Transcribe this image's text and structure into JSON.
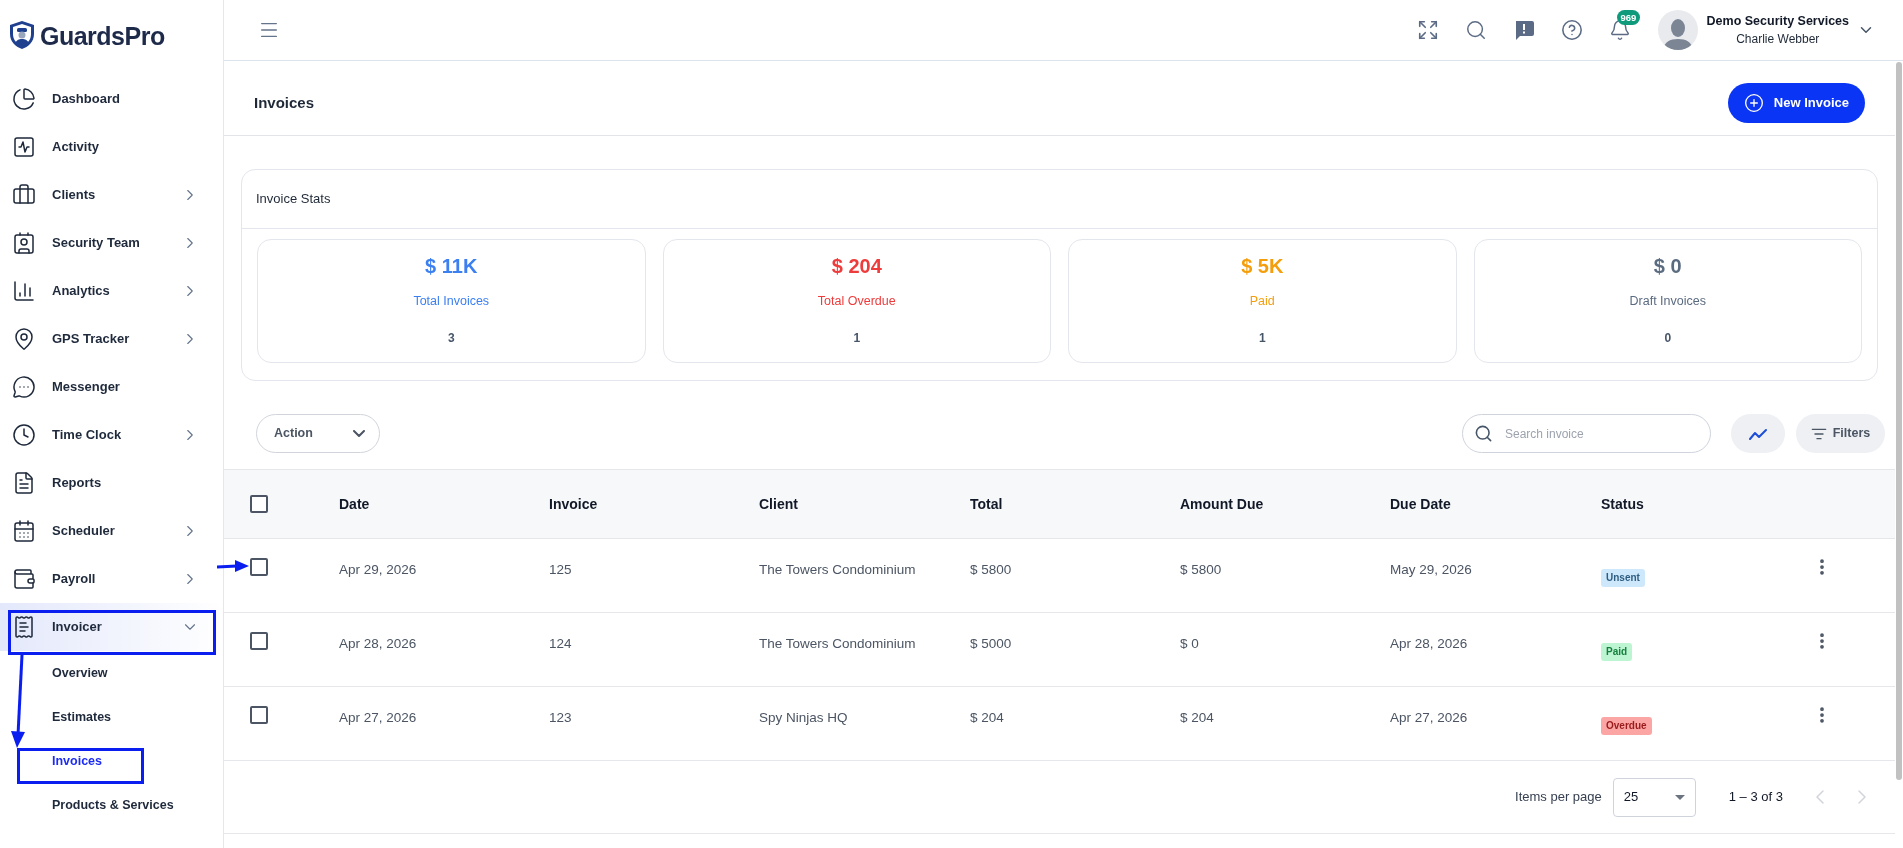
{
  "brand": "GuardsPro",
  "sidebar": {
    "items": [
      {
        "label": "Dashboard",
        "kind": "link",
        "selected": false
      },
      {
        "label": "Activity",
        "kind": "link",
        "selected": false
      },
      {
        "label": "Clients",
        "kind": "group",
        "expanded": false,
        "selected": false
      },
      {
        "label": "Security Team",
        "kind": "group",
        "expanded": false,
        "selected": false
      },
      {
        "label": "Analytics",
        "kind": "group",
        "expanded": false,
        "selected": false
      },
      {
        "label": "GPS Tracker",
        "kind": "group",
        "expanded": false,
        "selected": false
      },
      {
        "label": "Messenger",
        "kind": "link",
        "selected": false
      },
      {
        "label": "Time Clock",
        "kind": "group",
        "expanded": false,
        "selected": false
      },
      {
        "label": "Reports",
        "kind": "link",
        "selected": false
      },
      {
        "label": "Scheduler",
        "kind": "group",
        "expanded": false,
        "selected": false
      },
      {
        "label": "Payroll",
        "kind": "group",
        "expanded": false,
        "selected": false
      },
      {
        "label": "Invoicer",
        "kind": "group",
        "expanded": true,
        "selected": true,
        "children": [
          {
            "label": "Overview",
            "selected": false
          },
          {
            "label": "Estimates",
            "selected": false
          },
          {
            "label": "Invoices",
            "selected": true
          },
          {
            "label": "Products & Services",
            "selected": false
          }
        ]
      }
    ]
  },
  "header": {
    "notification_count": "969",
    "user": {
      "company": "Demo Security Services",
      "name": "Charlie Webber"
    }
  },
  "page": {
    "title": "Invoices",
    "new_button": "New Invoice"
  },
  "stats": {
    "title": "Invoice Stats",
    "cards": [
      {
        "value": "$ 11K",
        "label": "Total Invoices",
        "count": "3",
        "color": "#3b7ff0"
      },
      {
        "value": "$ 204",
        "label": "Total Overdue",
        "count": "1",
        "color": "#ee3b3b"
      },
      {
        "value": "$ 5K",
        "label": "Paid",
        "count": "1",
        "color": "#f59e0b"
      },
      {
        "value": "$ 0",
        "label": "Draft Invoices",
        "count": "0",
        "color": "#5b6b80"
      }
    ]
  },
  "toolbar": {
    "action": "Action",
    "search_placeholder": "Search invoice",
    "filters": "Filters"
  },
  "table": {
    "all_checked": false,
    "columns": [
      "Date",
      "Invoice",
      "Client",
      "Total",
      "Amount Due",
      "Due Date",
      "Status"
    ],
    "rows": [
      {
        "checked": false,
        "cells": [
          "Apr 29, 2026",
          "125",
          "The Towers Condominium",
          "$ 5800",
          "$ 5800",
          "May 29, 2026"
        ],
        "status": {
          "label": "Unsent",
          "kind": "unsent"
        }
      },
      {
        "checked": false,
        "cells": [
          "Apr 28, 2026",
          "124",
          "The Towers Condominium",
          "$ 5000",
          "$ 0",
          "Apr 28, 2026"
        ],
        "status": {
          "label": "Paid",
          "kind": "paid"
        }
      },
      {
        "checked": false,
        "cells": [
          "Apr 27, 2026",
          "123",
          "Spy Ninjas HQ",
          "$ 204",
          "$ 204",
          "Apr 27, 2026"
        ],
        "status": {
          "label": "Overdue",
          "kind": "overdue"
        }
      }
    ]
  },
  "pagination": {
    "label": "Items per page",
    "page_size": "25",
    "range": "1 – 3 of 3",
    "prev_disabled": true,
    "next_disabled": true
  }
}
